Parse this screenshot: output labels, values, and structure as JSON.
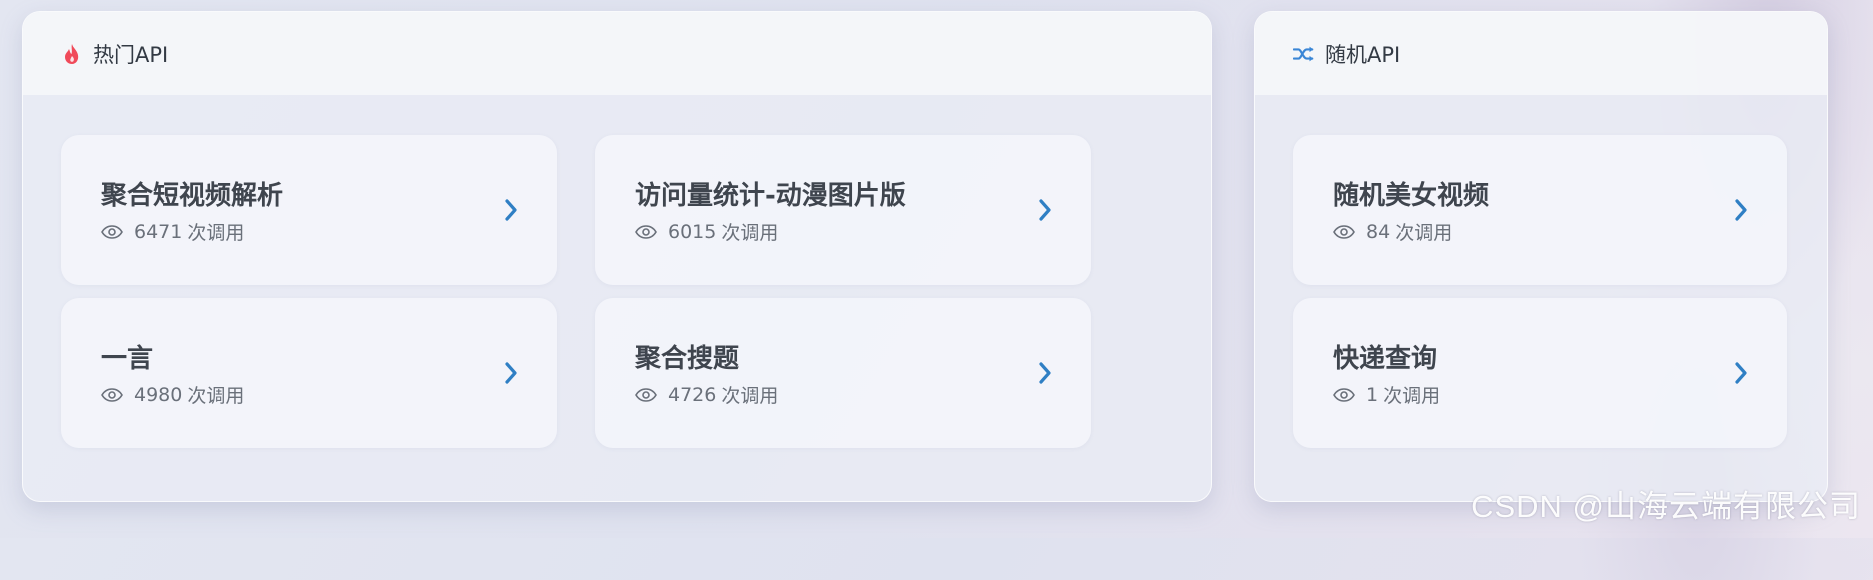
{
  "colors": {
    "hot_icon": "#f04a5a",
    "random_icon": "#3a86d6",
    "chevron": "#2f7fc4"
  },
  "hot_panel": {
    "icon": "fire-icon",
    "title": "热门API",
    "cards": [
      {
        "title": "聚合短视频解析",
        "count": "6471",
        "unit": "次调用"
      },
      {
        "title": "访问量统计-动漫图片版",
        "count": "6015",
        "unit": "次调用"
      },
      {
        "title": "一言",
        "count": "4980",
        "unit": "次调用"
      },
      {
        "title": "聚合搜题",
        "count": "4726",
        "unit": "次调用"
      }
    ]
  },
  "random_panel": {
    "icon": "shuffle-icon",
    "title": "随机API",
    "cards": [
      {
        "title": "随机美女视频",
        "count": "84",
        "unit": "次调用"
      },
      {
        "title": "快递查询",
        "count": "1",
        "unit": "次调用"
      }
    ]
  },
  "watermark": "CSDN @山海云端有限公司"
}
